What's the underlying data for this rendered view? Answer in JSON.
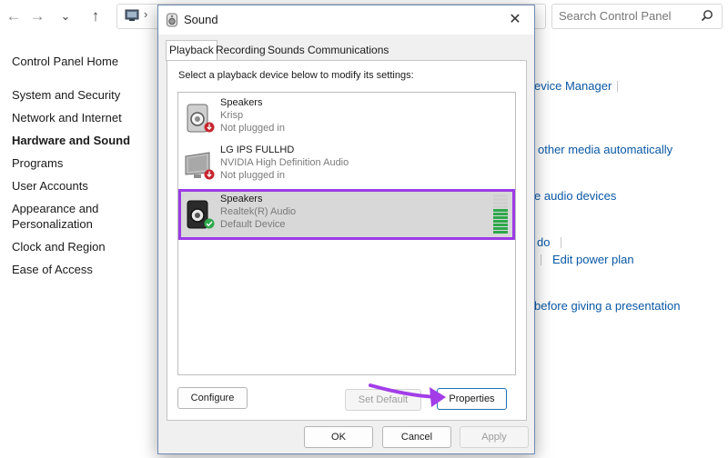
{
  "control_panel": {
    "search_placeholder": "Search Control Panel",
    "sidebar": {
      "home": "Control Panel Home",
      "items": [
        {
          "label": "System and Security"
        },
        {
          "label": "Network and Internet"
        },
        {
          "label": "Hardware and Sound",
          "active": true
        },
        {
          "label": "Programs"
        },
        {
          "label": "User Accounts"
        },
        {
          "label": "Appearance and Personalization"
        },
        {
          "label": "Clock and Region"
        },
        {
          "label": "Ease of Access"
        }
      ]
    },
    "right_links": {
      "device_manager": "evice Manager",
      "media_auto": "other media automatically",
      "audio_devices": "e audio devices",
      "do": "do",
      "power_plan": "Edit power plan",
      "presentation": "before giving a presentation"
    }
  },
  "dialog": {
    "title": "Sound",
    "tabs": [
      "Playback",
      "Recording",
      "Sounds",
      "Communications"
    ],
    "instruction": "Select a playback device below to modify its settings:",
    "devices": [
      {
        "name": "Speakers",
        "driver": "Krisp",
        "status": "Not plugged in",
        "icon": "speaker-icon",
        "badge": "unplugged"
      },
      {
        "name": "LG IPS FULLHD",
        "driver": "NVIDIA High Definition Audio",
        "status": "Not plugged in",
        "icon": "monitor-icon",
        "badge": "unplugged"
      },
      {
        "name": "Speakers",
        "driver": "Realtek(R) Audio",
        "status": "Default Device",
        "icon": "speaker-icon",
        "badge": "default",
        "selected": true
      }
    ],
    "buttons": {
      "configure": "Configure",
      "set_default": "Set Default",
      "properties": "Properties",
      "ok": "OK",
      "cancel": "Cancel",
      "apply": "Apply"
    }
  },
  "colors": {
    "highlight_outline": "#9b3be6",
    "annotation_arrow": "#a23de8",
    "link": "#0a58a6",
    "meter_green": "#2ea84b"
  }
}
